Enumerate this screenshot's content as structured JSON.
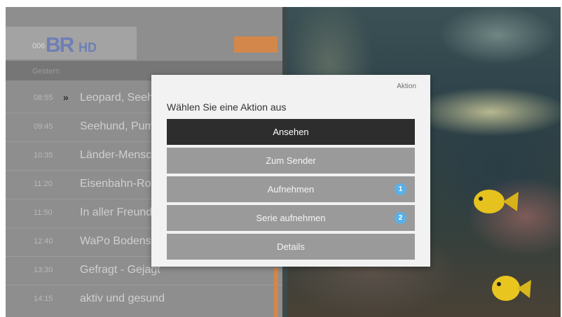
{
  "channel": {
    "number": "006",
    "logo_text": "BR",
    "hd_text": "HD",
    "logo_color": "#6f7fb6"
  },
  "header_button_label": "",
  "day_label": "Gestern",
  "programs": [
    {
      "time": "08:55",
      "title": "Leopard, Seehund & Co.",
      "current": true
    },
    {
      "time": "09:45",
      "title": "Seehund, Puma & Co.",
      "current": false
    },
    {
      "time": "10:35",
      "title": "Länder-Menschen-Abenteuer",
      "current": false
    },
    {
      "time": "11:20",
      "title": "Eisenbahn-Romantik",
      "current": false
    },
    {
      "time": "11:50",
      "title": "In aller Freundschaft",
      "current": false
    },
    {
      "time": "12:40",
      "title": "WaPo Bodensee",
      "current": false
    },
    {
      "time": "13:30",
      "title": "Gefragt - Gejagt",
      "current": false
    },
    {
      "time": "14:15",
      "title": "aktiv und gesund",
      "current": false
    }
  ],
  "current_marker": "»",
  "dialog": {
    "tag": "Aktion",
    "title": "Wählen Sie eine Aktion aus",
    "actions": [
      {
        "label": "Ansehen",
        "selected": true,
        "badge": ""
      },
      {
        "label": "Zum Sender",
        "selected": false,
        "badge": ""
      },
      {
        "label": "Aufnehmen",
        "selected": false,
        "badge": "1"
      },
      {
        "label": "Serie aufnehmen",
        "selected": false,
        "badge": "2"
      },
      {
        "label": "Details",
        "selected": false,
        "badge": ""
      }
    ]
  },
  "colors": {
    "accent_orange": "#d4874a",
    "selected_action": "#2d2d2d",
    "action_bg": "#9a9a9a",
    "badge_blue": "#5ab0e8"
  }
}
